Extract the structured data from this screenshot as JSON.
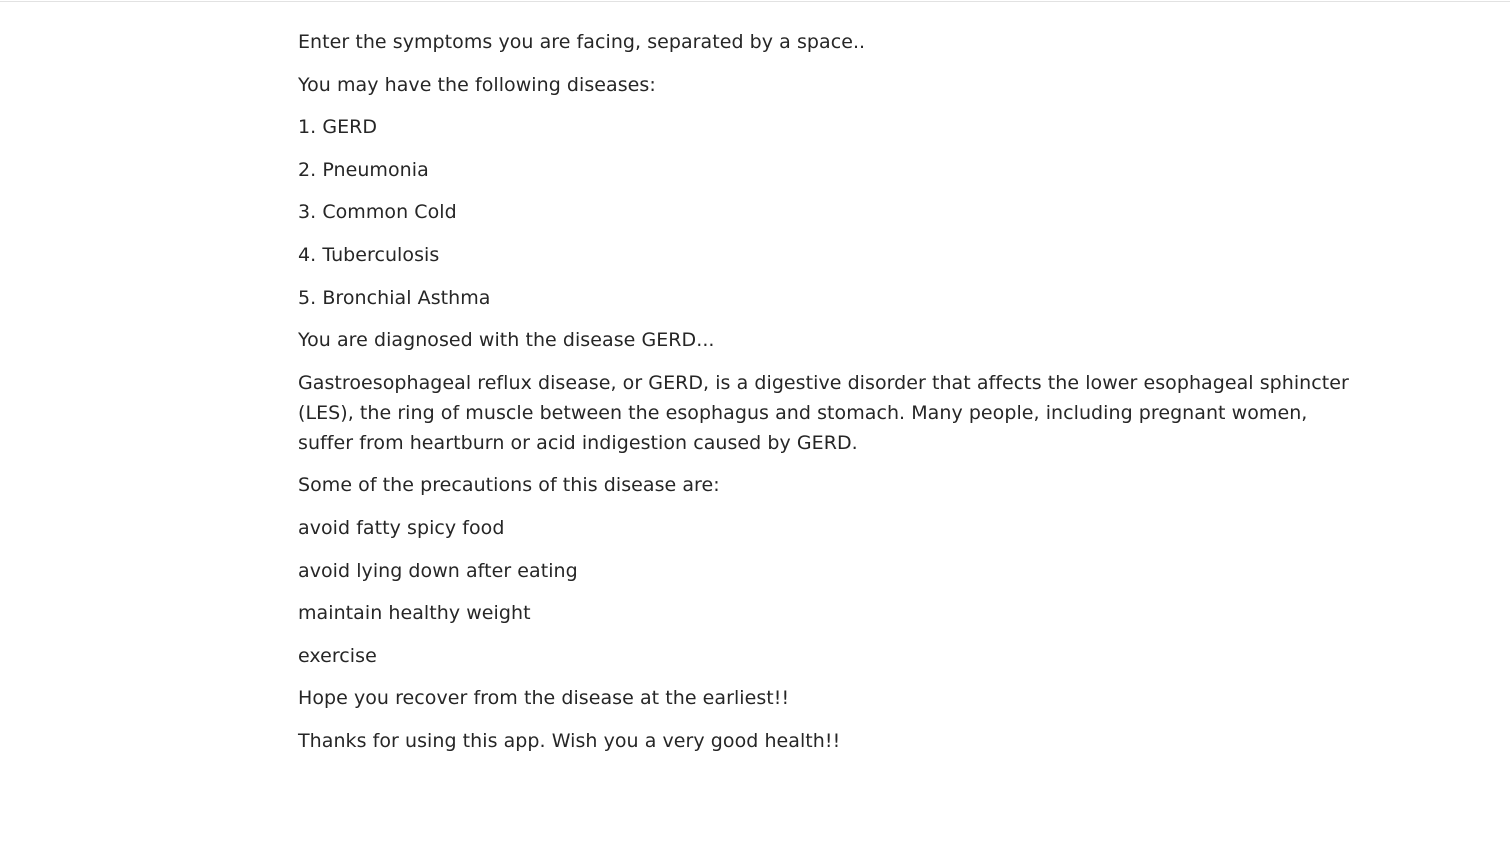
{
  "output": {
    "prompt_text": "Enter the symptoms you are facing, separated by a space..",
    "diseases_intro": "You may have the following diseases:",
    "disease_list": [
      "1. GERD",
      "2. Pneumonia",
      "3. Common Cold",
      "4. Tuberculosis",
      "5. Bronchial Asthma"
    ],
    "diagnosis": "You are diagnosed with the disease GERD...",
    "description": "Gastroesophageal reflux disease, or GERD, is a digestive disorder that affects the lower esophageal sphincter (LES), the ring of muscle between the esophagus and stomach. Many people, including pregnant women, suffer from heartburn or acid indigestion caused by GERD.",
    "precautions_intro": "Some of the precautions of this disease are:",
    "precautions": [
      "avoid fatty spicy food",
      "avoid lying down after eating",
      "maintain healthy weight",
      "exercise"
    ],
    "recovery_message": "Hope you recover from the disease at the earliest!!",
    "thanks_message": "Thanks for using this app. Wish you a very good health!!"
  }
}
